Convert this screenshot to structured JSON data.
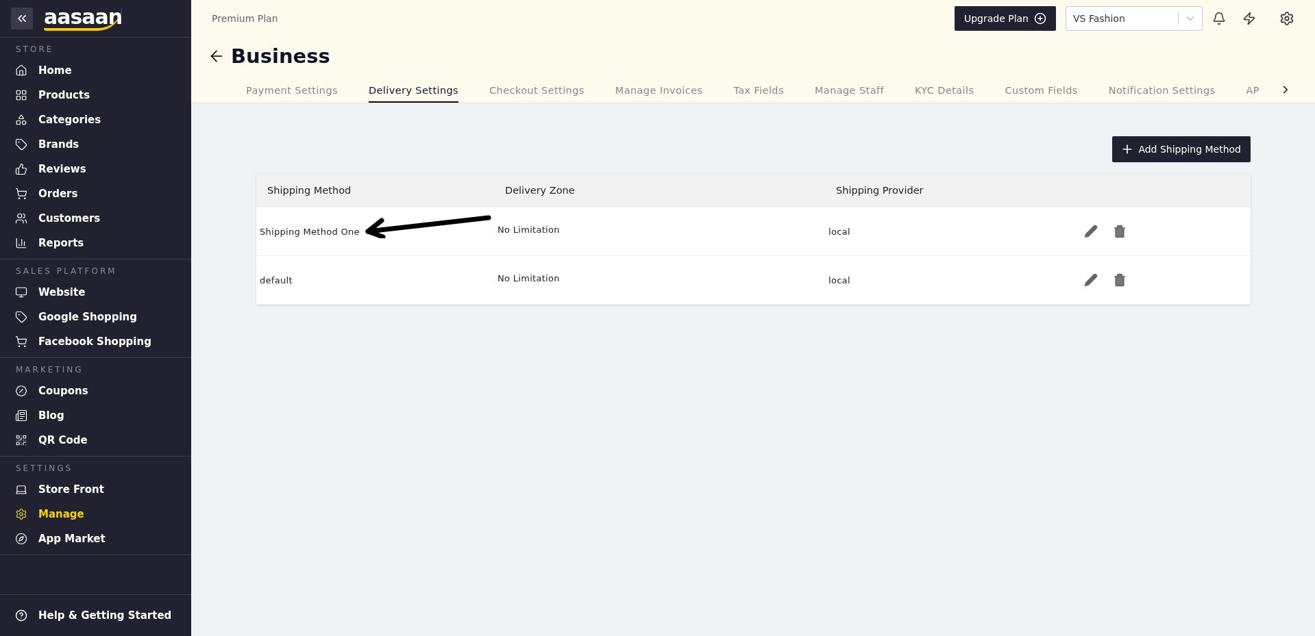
{
  "sidebar": {
    "logo": "aasaan",
    "sections": [
      {
        "title": "STORE",
        "items": [
          {
            "label": "Home",
            "kind": "home",
            "selected": false
          },
          {
            "label": "Products",
            "kind": "products",
            "selected": false
          },
          {
            "label": "Categories",
            "kind": "categories",
            "selected": false
          },
          {
            "label": "Brands",
            "kind": "tag",
            "selected": false
          },
          {
            "label": "Reviews",
            "kind": "reviews",
            "selected": false
          },
          {
            "label": "Orders",
            "kind": "cart",
            "selected": false
          },
          {
            "label": "Customers",
            "kind": "users",
            "selected": false
          },
          {
            "label": "Reports",
            "kind": "chart",
            "selected": false
          }
        ]
      },
      {
        "title": "SALES PLATFORM",
        "items": [
          {
            "label": "Website",
            "kind": "monitor",
            "selected": false
          },
          {
            "label": "Google Shopping",
            "kind": "tag",
            "selected": false
          },
          {
            "label": "Facebook Shopping",
            "kind": "cart",
            "selected": false
          }
        ]
      },
      {
        "title": "MARKETING",
        "items": [
          {
            "label": "Coupons",
            "kind": "coupon",
            "selected": false
          },
          {
            "label": "Blog",
            "kind": "blog",
            "selected": false
          },
          {
            "label": "QR Code",
            "kind": "qr",
            "selected": false
          }
        ]
      },
      {
        "title": "SETTINGS",
        "items": [
          {
            "label": "Store Front",
            "kind": "laptop",
            "selected": false
          },
          {
            "label": "Manage",
            "kind": "gear",
            "selected": true
          },
          {
            "label": "App Market",
            "kind": "appstore",
            "selected": false
          }
        ]
      }
    ],
    "help": "Help & Getting Started"
  },
  "header": {
    "plan": "Premium Plan",
    "upgrade_button": "Upgrade Plan",
    "store_select": {
      "value": "VS Fashion"
    },
    "title": "Business"
  },
  "tabs": [
    {
      "label": "Payment Settings",
      "selected": false
    },
    {
      "label": "Delivery Settings",
      "selected": true
    },
    {
      "label": "Checkout Settings",
      "selected": false
    },
    {
      "label": "Manage Invoices",
      "selected": false
    },
    {
      "label": "Tax Fields",
      "selected": false
    },
    {
      "label": "Manage Staff",
      "selected": false
    },
    {
      "label": "KYC Details",
      "selected": false
    },
    {
      "label": "Custom Fields",
      "selected": false
    },
    {
      "label": "Notification Settings",
      "selected": false
    },
    {
      "label": "AP",
      "selected": false
    }
  ],
  "add_button": "Add Shipping Method",
  "table": {
    "columns": [
      "Shipping Method",
      "Delivery Zone",
      "Shipping Provider"
    ],
    "rows": [
      {
        "method": "Shipping Method One",
        "zone": "No Limitation",
        "provider": "local"
      },
      {
        "method": "default",
        "zone": "No Limitation",
        "provider": "local"
      }
    ]
  }
}
